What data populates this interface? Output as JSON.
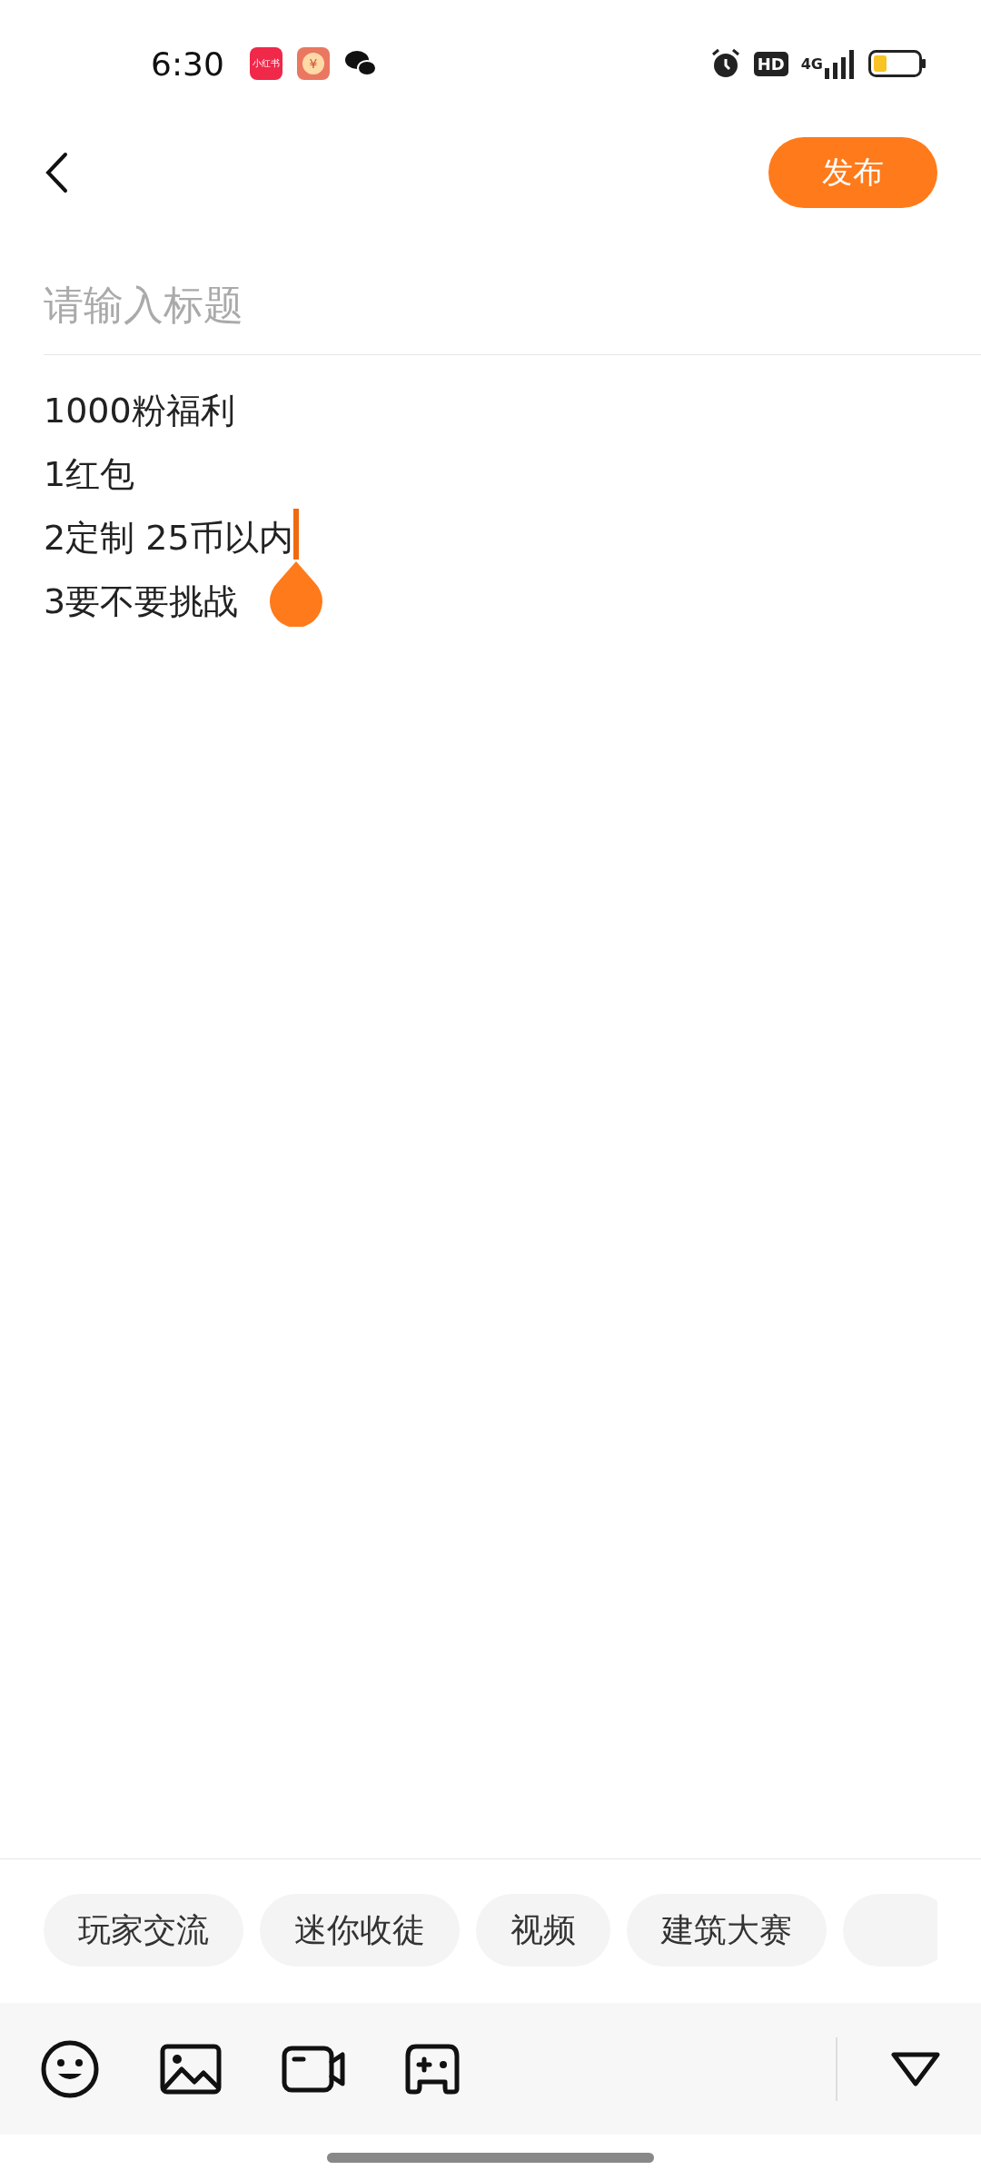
{
  "status_bar": {
    "time": "6:30",
    "app_icons": [
      {
        "kind": "red-note",
        "label": "小红书"
      },
      {
        "kind": "coin",
        "label": "¥"
      },
      {
        "kind": "chat"
      }
    ],
    "hd": "HD",
    "network": "4G"
  },
  "header": {
    "publish": "发布"
  },
  "title_field": {
    "placeholder": "请输入标题"
  },
  "body_lines": [
    {
      "text": "1000粉福利",
      "cursor": false
    },
    {
      "text": "1红包",
      "cursor": false
    },
    {
      "text": "2定制 25币以内",
      "cursor": true
    },
    {
      "text": "3要不要挑战",
      "cursor": false
    }
  ],
  "tags": [
    "玩家交流",
    "迷你收徒",
    "视频",
    "建筑大赛"
  ],
  "toolbar": [
    {
      "kind": "emoji"
    },
    {
      "kind": "image"
    },
    {
      "kind": "video"
    },
    {
      "kind": "game"
    }
  ]
}
